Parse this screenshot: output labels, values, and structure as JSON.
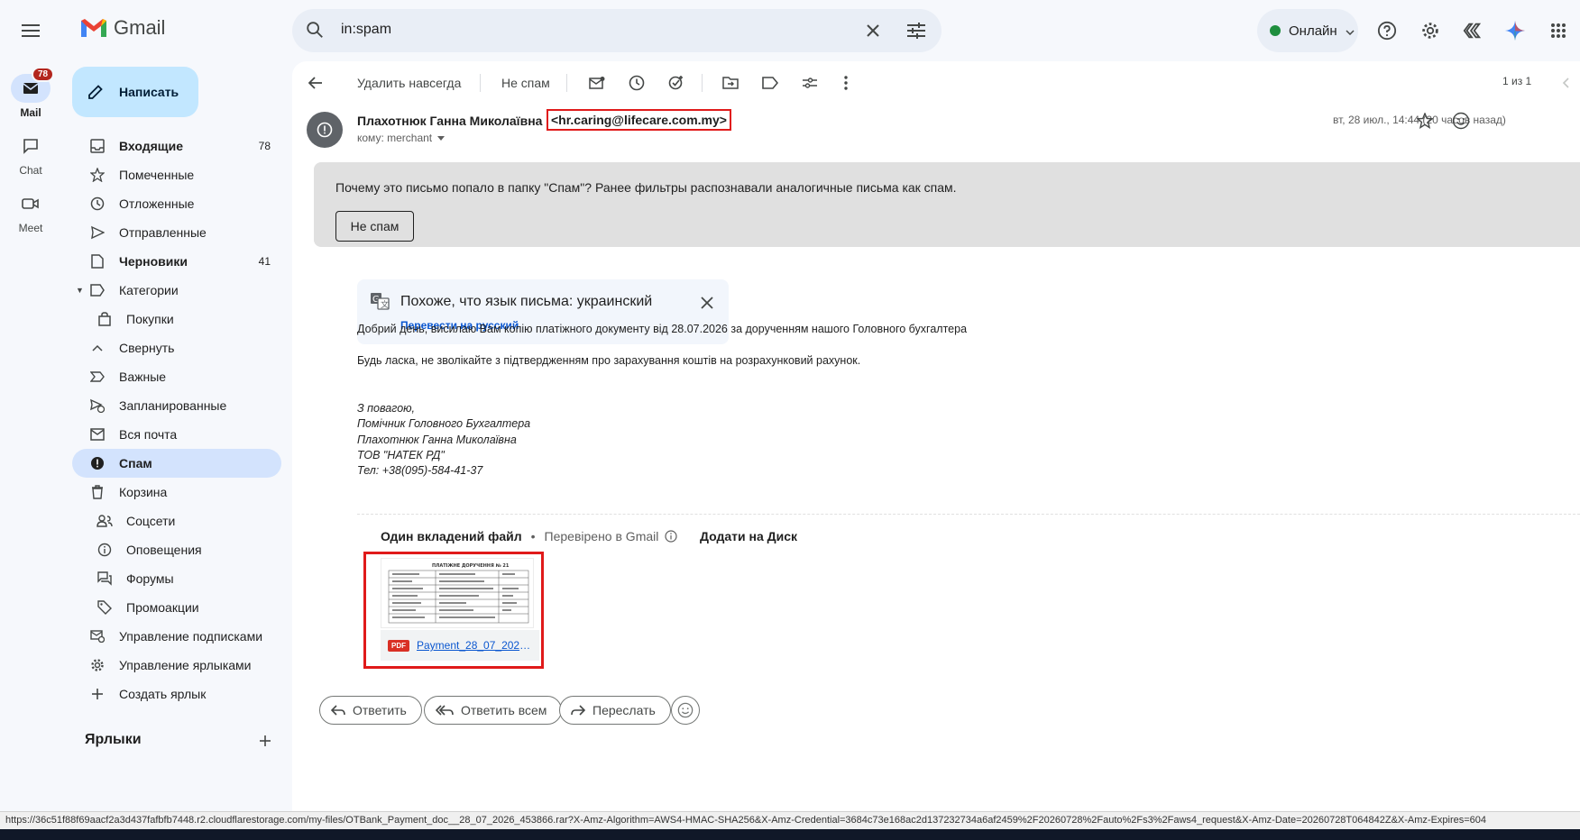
{
  "app": {
    "name": "Gmail"
  },
  "search": {
    "query": "in:spam"
  },
  "status": {
    "label": "Онлайн",
    "color": "#1e8e3e"
  },
  "rail": [
    {
      "label": "Mail",
      "badge": "78"
    },
    {
      "label": "Chat"
    },
    {
      "label": "Meet"
    }
  ],
  "compose": {
    "label": "Написать"
  },
  "nav": [
    {
      "label": "Входящие",
      "count": "78"
    },
    {
      "label": "Помеченные"
    },
    {
      "label": "Отложенные"
    },
    {
      "label": "Отправленные"
    },
    {
      "label": "Черновики",
      "count": "41"
    },
    {
      "label": "Категории"
    },
    {
      "label": "Покупки"
    },
    {
      "label": "Свернуть"
    },
    {
      "label": "Важные"
    },
    {
      "label": "Запланированные"
    },
    {
      "label": "Вся почта"
    },
    {
      "label": "Спам"
    },
    {
      "label": "Корзина"
    },
    {
      "label": "Соцсети"
    },
    {
      "label": "Оповещения"
    },
    {
      "label": "Форумы"
    },
    {
      "label": "Промоакции"
    },
    {
      "label": "Управление подписками"
    },
    {
      "label": "Управление ярлыками"
    },
    {
      "label": "Создать ярлык"
    }
  ],
  "labels_section": {
    "title": "Ярлыки"
  },
  "toolbar": {
    "delete_forever": "Удалить навсегда",
    "not_spam": "Не спам",
    "pager": "1 из 1"
  },
  "message": {
    "sender_name": "Плахотнюк Ганна Миколаївна",
    "sender_email": "<hr.caring@lifecare.com.my>",
    "to": "кому: merchant",
    "date": "вт, 28 июл., 14:44 (20 часов назад)",
    "spam_reason_q": "Почему это письмо попало в папку \"Спам\"?",
    "spam_reason": " Ранее фильтры распознавали аналогичные письма как спам.",
    "not_spam_button": "Не спам",
    "translate_title": "Похоже, что язык письма: украинский",
    "translate_link": "Перевести на русский",
    "body_line1": "Добрий день, висилаю Вам копію платіжного документу від 28.07.2026 за дорученням нашого Головного бухгалтера",
    "body_line2": "Будь ласка, не зволікайте з підтвердженням про зарахування коштів на розрахунковий рахунок.",
    "signature": [
      "З повагою,",
      "Помічник Головного Бухгалтера",
      "Плахотнюк Ганна Миколаївна",
      "ТОВ \"НАТЕК РД\"",
      "Тел: +38(095)-584-41-37"
    ]
  },
  "attachments": {
    "count_label": "Один вкладений файл",
    "checked_label": "Перевірено в Gmail",
    "add_to_drive": "Додати на Диск",
    "file_name": "Payment_28_07_2026...",
    "file_type": "PDF",
    "preview_title": "ПЛАТІЖНЕ ДОРУЧЕННЯ № 21"
  },
  "actions": {
    "reply": "Ответить",
    "reply_all": "Ответить всем",
    "forward": "Переслать"
  },
  "status_url": "https://36c51f88f69aacf2a3d437fafbfb7448.r2.cloudflarestorage.com/my-files/OTBank_Payment_doc__28_07_2026_453866.rar?X-Amz-Algorithm=AWS4-HMAC-SHA256&X-Amz-Credential=3684c73e168ac2d137232734a6af2459%2F20260728%2Fauto%2Fs3%2Faws4_request&X-Amz-Date=20260728T064842Z&X-Amz-Expires=604"
}
